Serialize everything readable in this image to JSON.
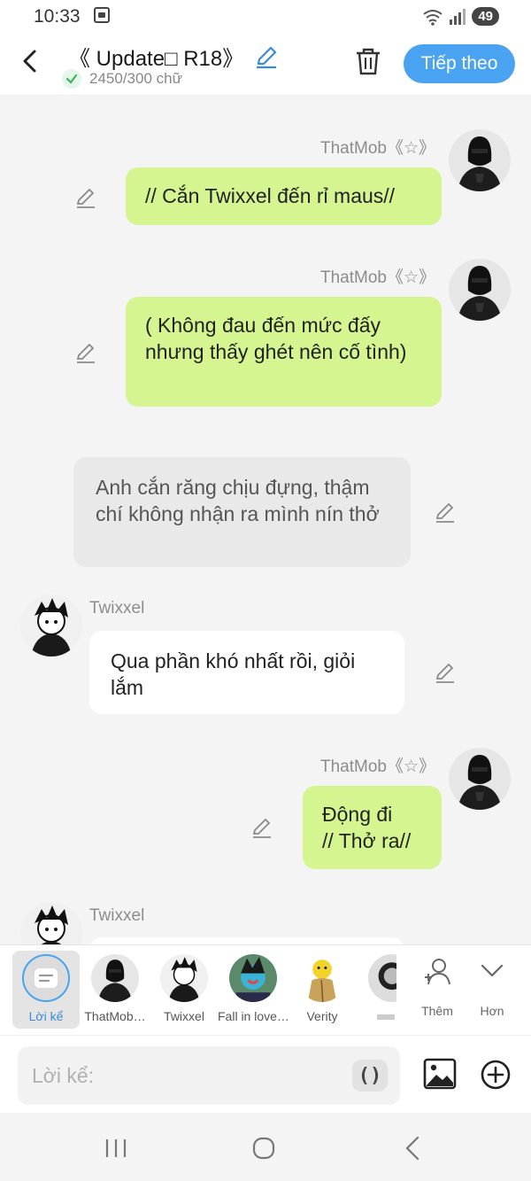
{
  "status": {
    "time": "10:33",
    "battery": "49"
  },
  "header": {
    "title": "《 Update□ R18》",
    "word_count": "2450/300 chữ",
    "next_label": "Tiếp theo"
  },
  "messages": [
    {
      "speaker": "ThatMob《☆》",
      "text": "// Cắn Twixxel đến rỉ maus//"
    },
    {
      "speaker": "ThatMob《☆》",
      "text": "( Không đau đến mức đấy nhưng thấy ghét nên cố tình)"
    },
    {
      "text": "Anh cắn răng chịu đựng, thậm chí không nhận ra mình nín thở"
    },
    {
      "speaker": "Twixxel",
      "text": "Qua phần khó nhất rồi, giỏi lắm"
    },
    {
      "speaker": "ThatMob《☆》",
      "text": "Động đi\n// Thở ra//"
    },
    {
      "speaker": "Twixxel"
    }
  ],
  "characters": {
    "narration_label": "Lời kể",
    "items": [
      "ThatMob…",
      "Twixxel",
      "Fall in love…",
      "Verity"
    ],
    "more_label": "Thêm",
    "less_label": "Hơn"
  },
  "composer": {
    "placeholder": "Lời kể:",
    "paren_label": "()"
  }
}
